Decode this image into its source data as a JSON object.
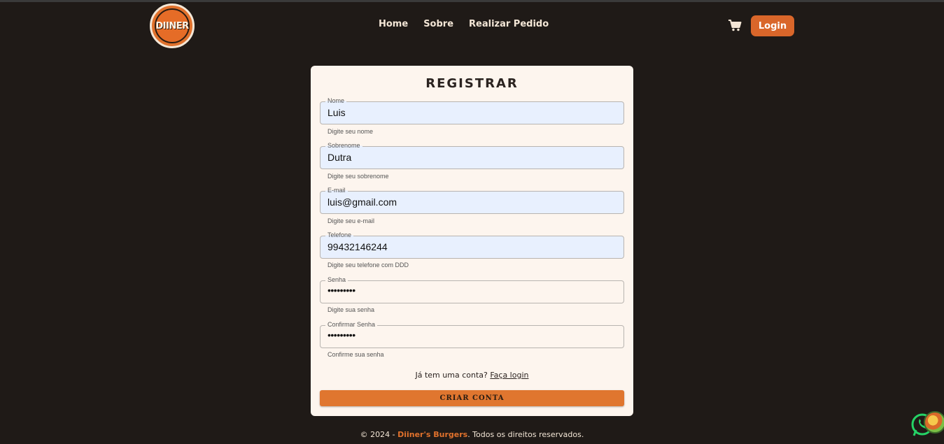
{
  "header": {
    "logo_text": "DIINER",
    "nav": [
      {
        "label": "Home"
      },
      {
        "label": "Sobre"
      },
      {
        "label": "Realizar Pedido"
      }
    ],
    "cart_icon": "cart-icon",
    "login_label": "Login"
  },
  "form": {
    "title": "REGISTRAR",
    "fields": [
      {
        "label": "Nome",
        "value": "Luis",
        "helper": "Digite seu nome"
      },
      {
        "label": "Sobrenome",
        "value": "Dutra",
        "helper": "Digite seu sobrenome"
      },
      {
        "label": "E-mail",
        "value": "luis@gmail.com",
        "helper": "Digite seu e-mail"
      },
      {
        "label": "Telefone",
        "value": "99432146244",
        "helper": "Digite seu telefone com DDD"
      },
      {
        "label": "Senha",
        "value": "•••••••••",
        "helper": "Digite sua senha"
      },
      {
        "label": "Confirmar Senha",
        "value": "•••••••••",
        "helper": "Confirme sua senha"
      }
    ],
    "already_text": "Já tem uma conta?",
    "login_link": "Faça login",
    "submit_label": "CRIAR CONTA"
  },
  "footer": {
    "prefix": "© 2024 - ",
    "brand": "Diiner's Burgers",
    "suffix": ". Todos os direitos reservados."
  },
  "colors": {
    "background": "#1f1a17",
    "accent": "#d9662a",
    "card": "#fdf5ee",
    "autofill": "#e8f0fe"
  }
}
